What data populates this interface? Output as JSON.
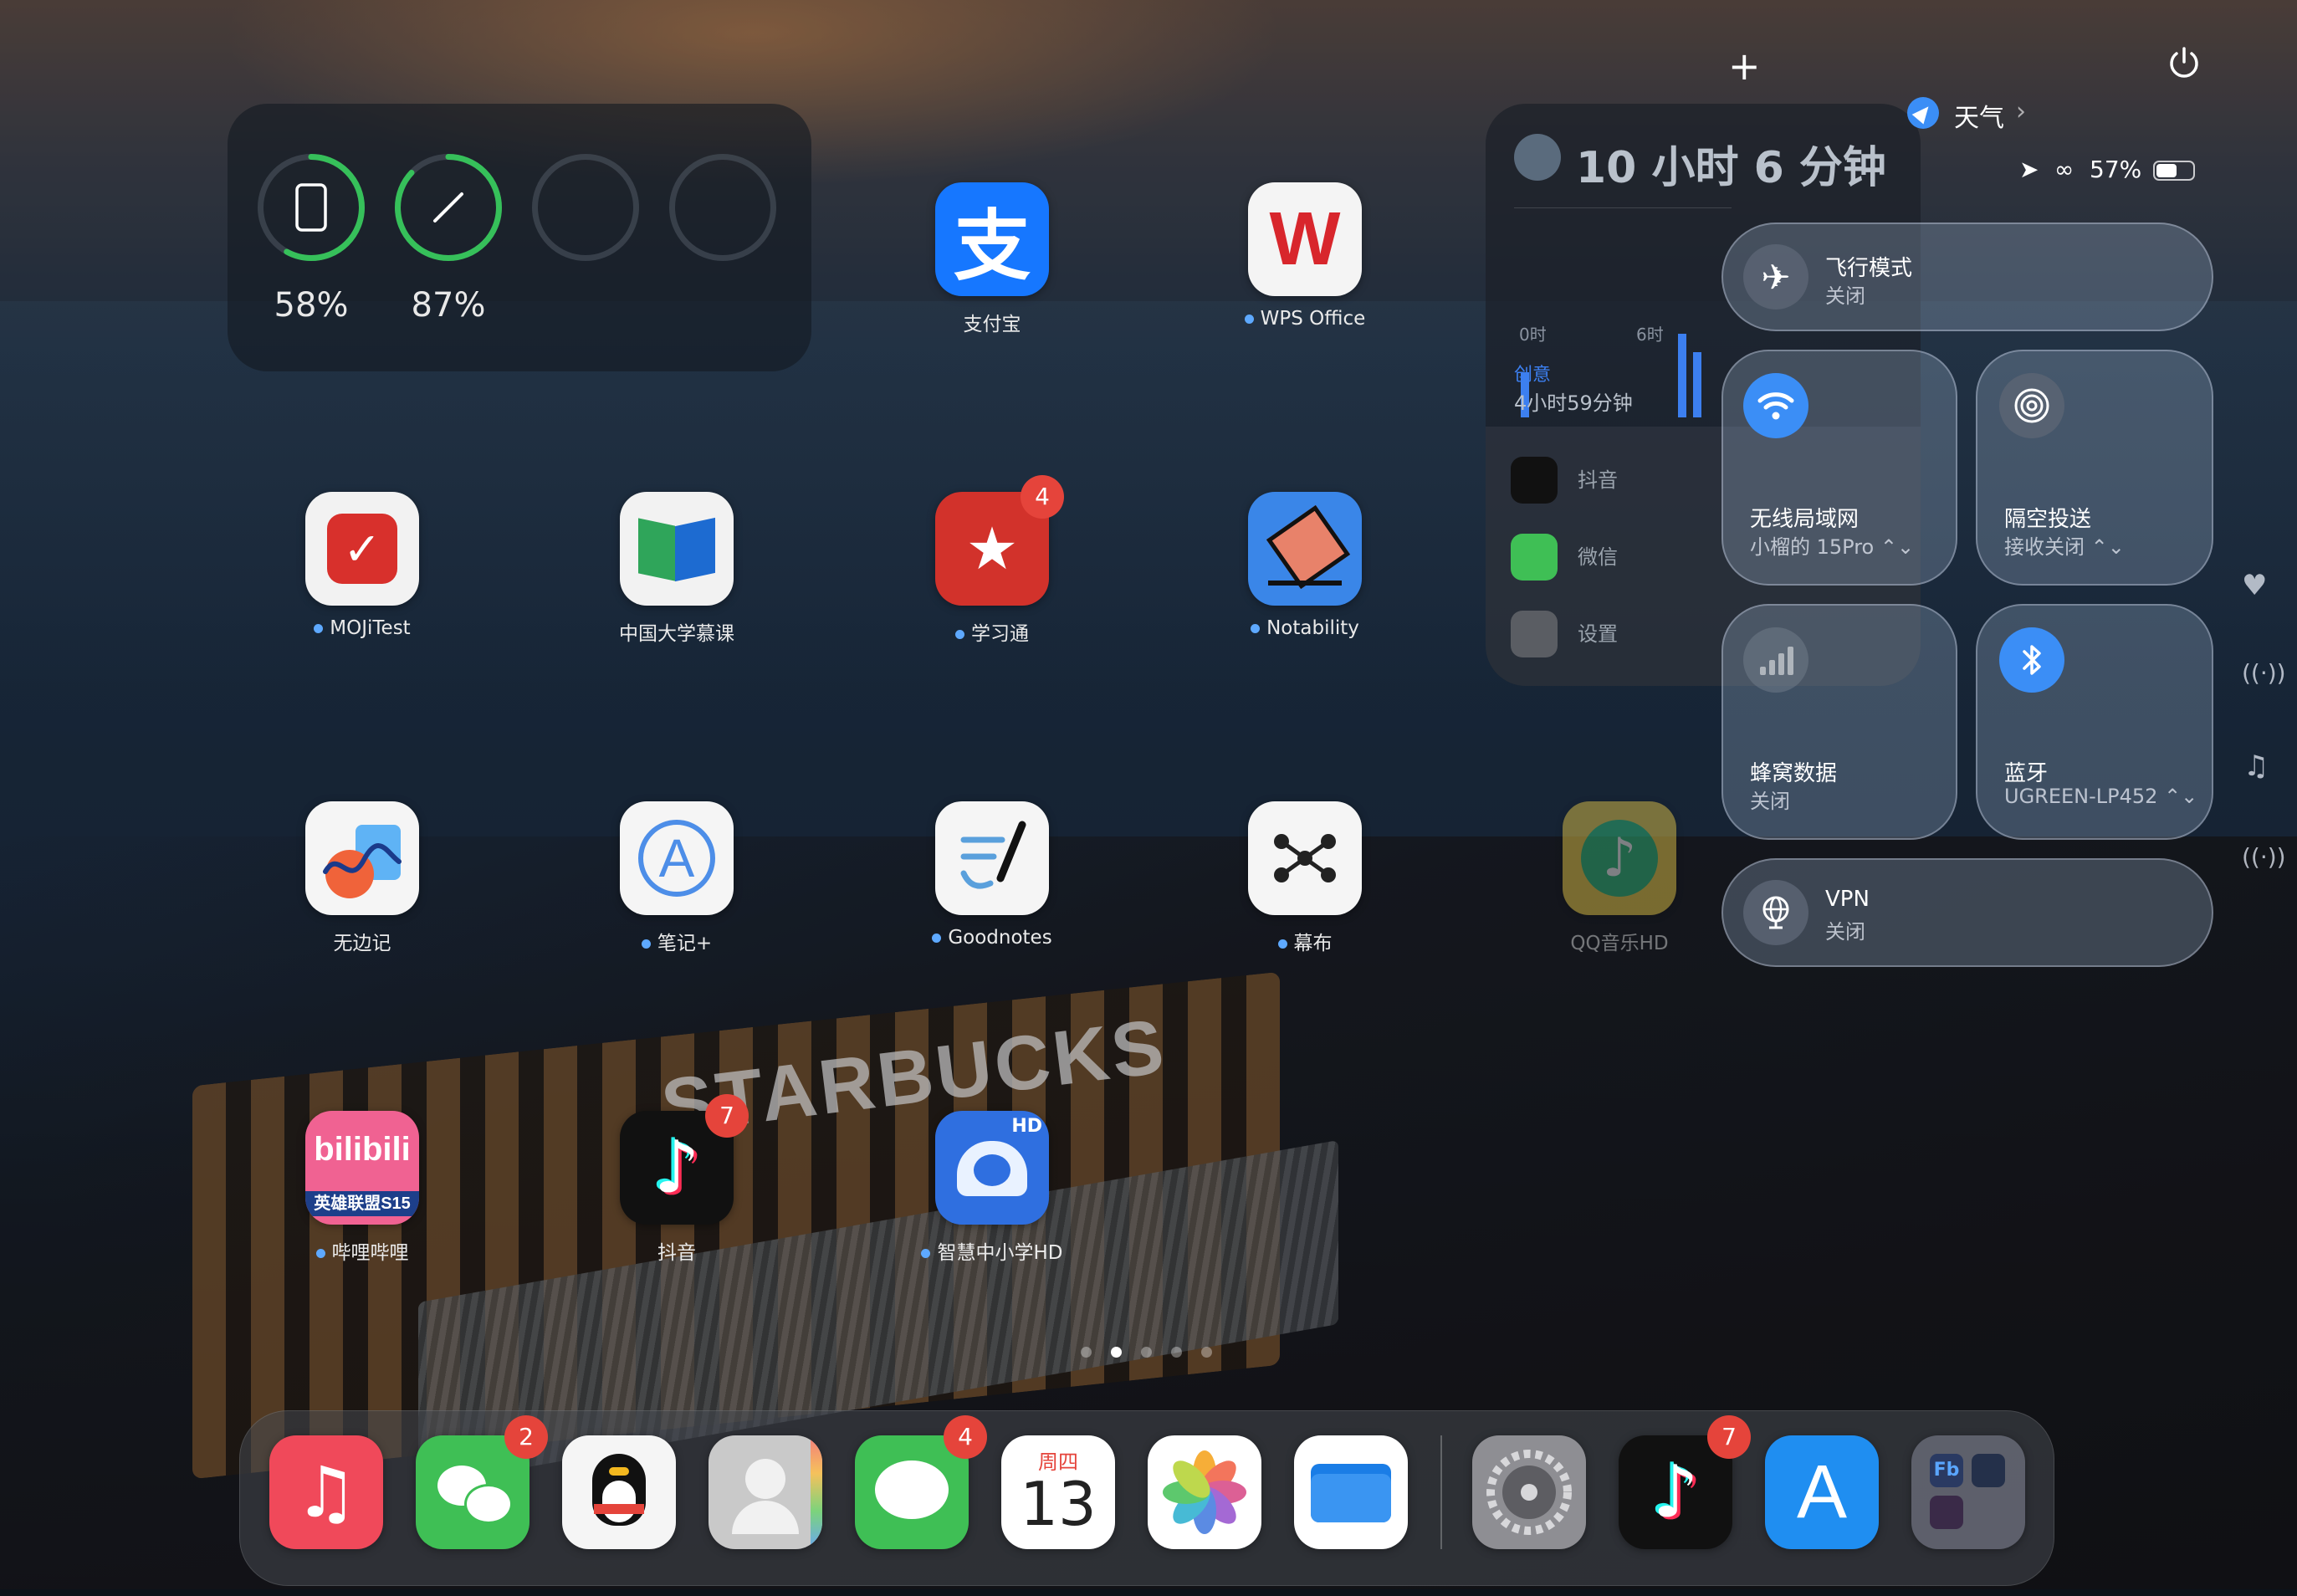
{
  "battery_widget": {
    "devices": [
      {
        "icon": "ipad-icon",
        "percent_label": "58%",
        "level": 0.58
      },
      {
        "icon": "pencil-icon",
        "percent_label": "87%",
        "level": 0.87
      },
      {
        "icon": "",
        "percent_label": "",
        "level": 0
      },
      {
        "icon": "",
        "percent_label": "",
        "level": 0
      }
    ]
  },
  "apps": [
    {
      "name": "支付宝",
      "icon": "alipay-icon",
      "color": "#1677ff",
      "dot": false
    },
    {
      "name": "WPS Office",
      "icon": "wps-icon",
      "color": "#f4f4f4",
      "dot": true
    },
    {
      "name": "MOJiTest",
      "icon": "mojitest-icon",
      "color": "#f2f2f2",
      "dot": true
    },
    {
      "name": "中国大学慕课",
      "icon": "mooc-icon",
      "color": "#f2f2f2",
      "dot": false
    },
    {
      "name": "学习通",
      "icon": "xuexitong-icon",
      "color": "#d2322b",
      "dot": true,
      "badge": "4"
    },
    {
      "name": "Notability",
      "icon": "notability-icon",
      "color": "#3a86e8",
      "dot": true
    },
    {
      "name": "无边记",
      "icon": "freeform-icon",
      "color": "#f5f5f5",
      "dot": false
    },
    {
      "name": "笔记+",
      "icon": "notesplus-icon",
      "color": "#f5f5f5",
      "dot": true
    },
    {
      "name": "Goodnotes",
      "icon": "goodnotes-icon",
      "color": "#f5f5f5",
      "dot": true
    },
    {
      "name": "幕布",
      "icon": "mubu-icon",
      "color": "#f5f5f5",
      "dot": true
    },
    {
      "name": "QQ音乐HD",
      "icon": "qqmusic-icon",
      "color": "#f3d24a",
      "dot": false
    },
    {
      "name": "哔哩哔哩",
      "icon": "bilibili-icon",
      "color": "#f06292",
      "dot": true,
      "icon_text_1": "bilibili",
      "icon_text_2": "英雄联盟S15"
    },
    {
      "name": "抖音",
      "icon": "douyin-icon",
      "color": "#111111",
      "dot": false,
      "badge": "7"
    },
    {
      "name": "智慧中小学HD",
      "icon": "smartedu-icon",
      "color": "#2f6fe0",
      "dot": true,
      "icon_text_1": "HD"
    }
  ],
  "screen_time": {
    "total": "10 小时 6 分钟",
    "axis_start": "0时",
    "axis_mid": "6时",
    "category": "创意",
    "category_time": "4小时59分钟",
    "apps": [
      {
        "name": "抖音",
        "icon": "douyin-icon"
      },
      {
        "name": "微信",
        "icon": "wechat-icon"
      },
      {
        "name": "设置",
        "icon": "settings-icon"
      }
    ]
  },
  "control_center": {
    "add_icon": "+",
    "power_icon": "power-icon",
    "weather_label": "天气",
    "battery_text": "57%",
    "battery_level": 0.57,
    "airplane": {
      "title": "飞行模式",
      "status": "关闭"
    },
    "wifi": {
      "title": "无线局域网",
      "status": "小榴的 15Pro ⌃⌄",
      "color": "#3b8ef6"
    },
    "airdrop": {
      "title": "隔空投送",
      "status": "接收关闭 ⌃⌄"
    },
    "cellular": {
      "title": "蜂窝数据",
      "status": "关闭"
    },
    "bluetooth": {
      "title": "蓝牙",
      "status": "UGREEN-LP452 ⌃⌄",
      "color": "#3b8ef6"
    },
    "vpn": {
      "title": "VPN",
      "status": "关闭"
    }
  },
  "side_icons": [
    "heart-icon",
    "broadcast-icon",
    "music-note-icon",
    "antenna-icon"
  ],
  "page_dots": {
    "count": 5,
    "active": 1
  },
  "dock": [
    {
      "name": "音乐",
      "icon": "music-icon",
      "color": "#f0495a"
    },
    {
      "name": "微信",
      "icon": "wechat-icon",
      "color": "#3fbf55",
      "badge": "2"
    },
    {
      "name": "QQ",
      "icon": "qq-icon",
      "color": "#f5f5f5"
    },
    {
      "name": "通讯录",
      "icon": "contacts-icon",
      "color": "#c9c9c9"
    },
    {
      "name": "信息",
      "icon": "messages-icon",
      "color": "#3fbf55",
      "badge": "4"
    },
    {
      "name": "日历",
      "icon": "calendar-icon",
      "color": "#ffffff",
      "weekday": "周四",
      "day": "13"
    },
    {
      "name": "照片",
      "icon": "photos-icon",
      "color": "#ffffff"
    },
    {
      "name": "文件",
      "icon": "files-icon",
      "color": "#ffffff"
    },
    {
      "name": "设置",
      "icon": "settings-icon",
      "color": "#8e8e93"
    },
    {
      "name": "抖音",
      "icon": "douyin-icon",
      "color": "#111111",
      "badge": "7"
    },
    {
      "name": "App Store",
      "icon": "appstore-icon",
      "color": "#1f8ef1"
    },
    {
      "name": "Affinity",
      "icon": "affinity-folder-icon",
      "color": "#5a5a68",
      "icon_text_1": "Fb"
    }
  ],
  "wallpaper_sign": "STARBUCKS"
}
